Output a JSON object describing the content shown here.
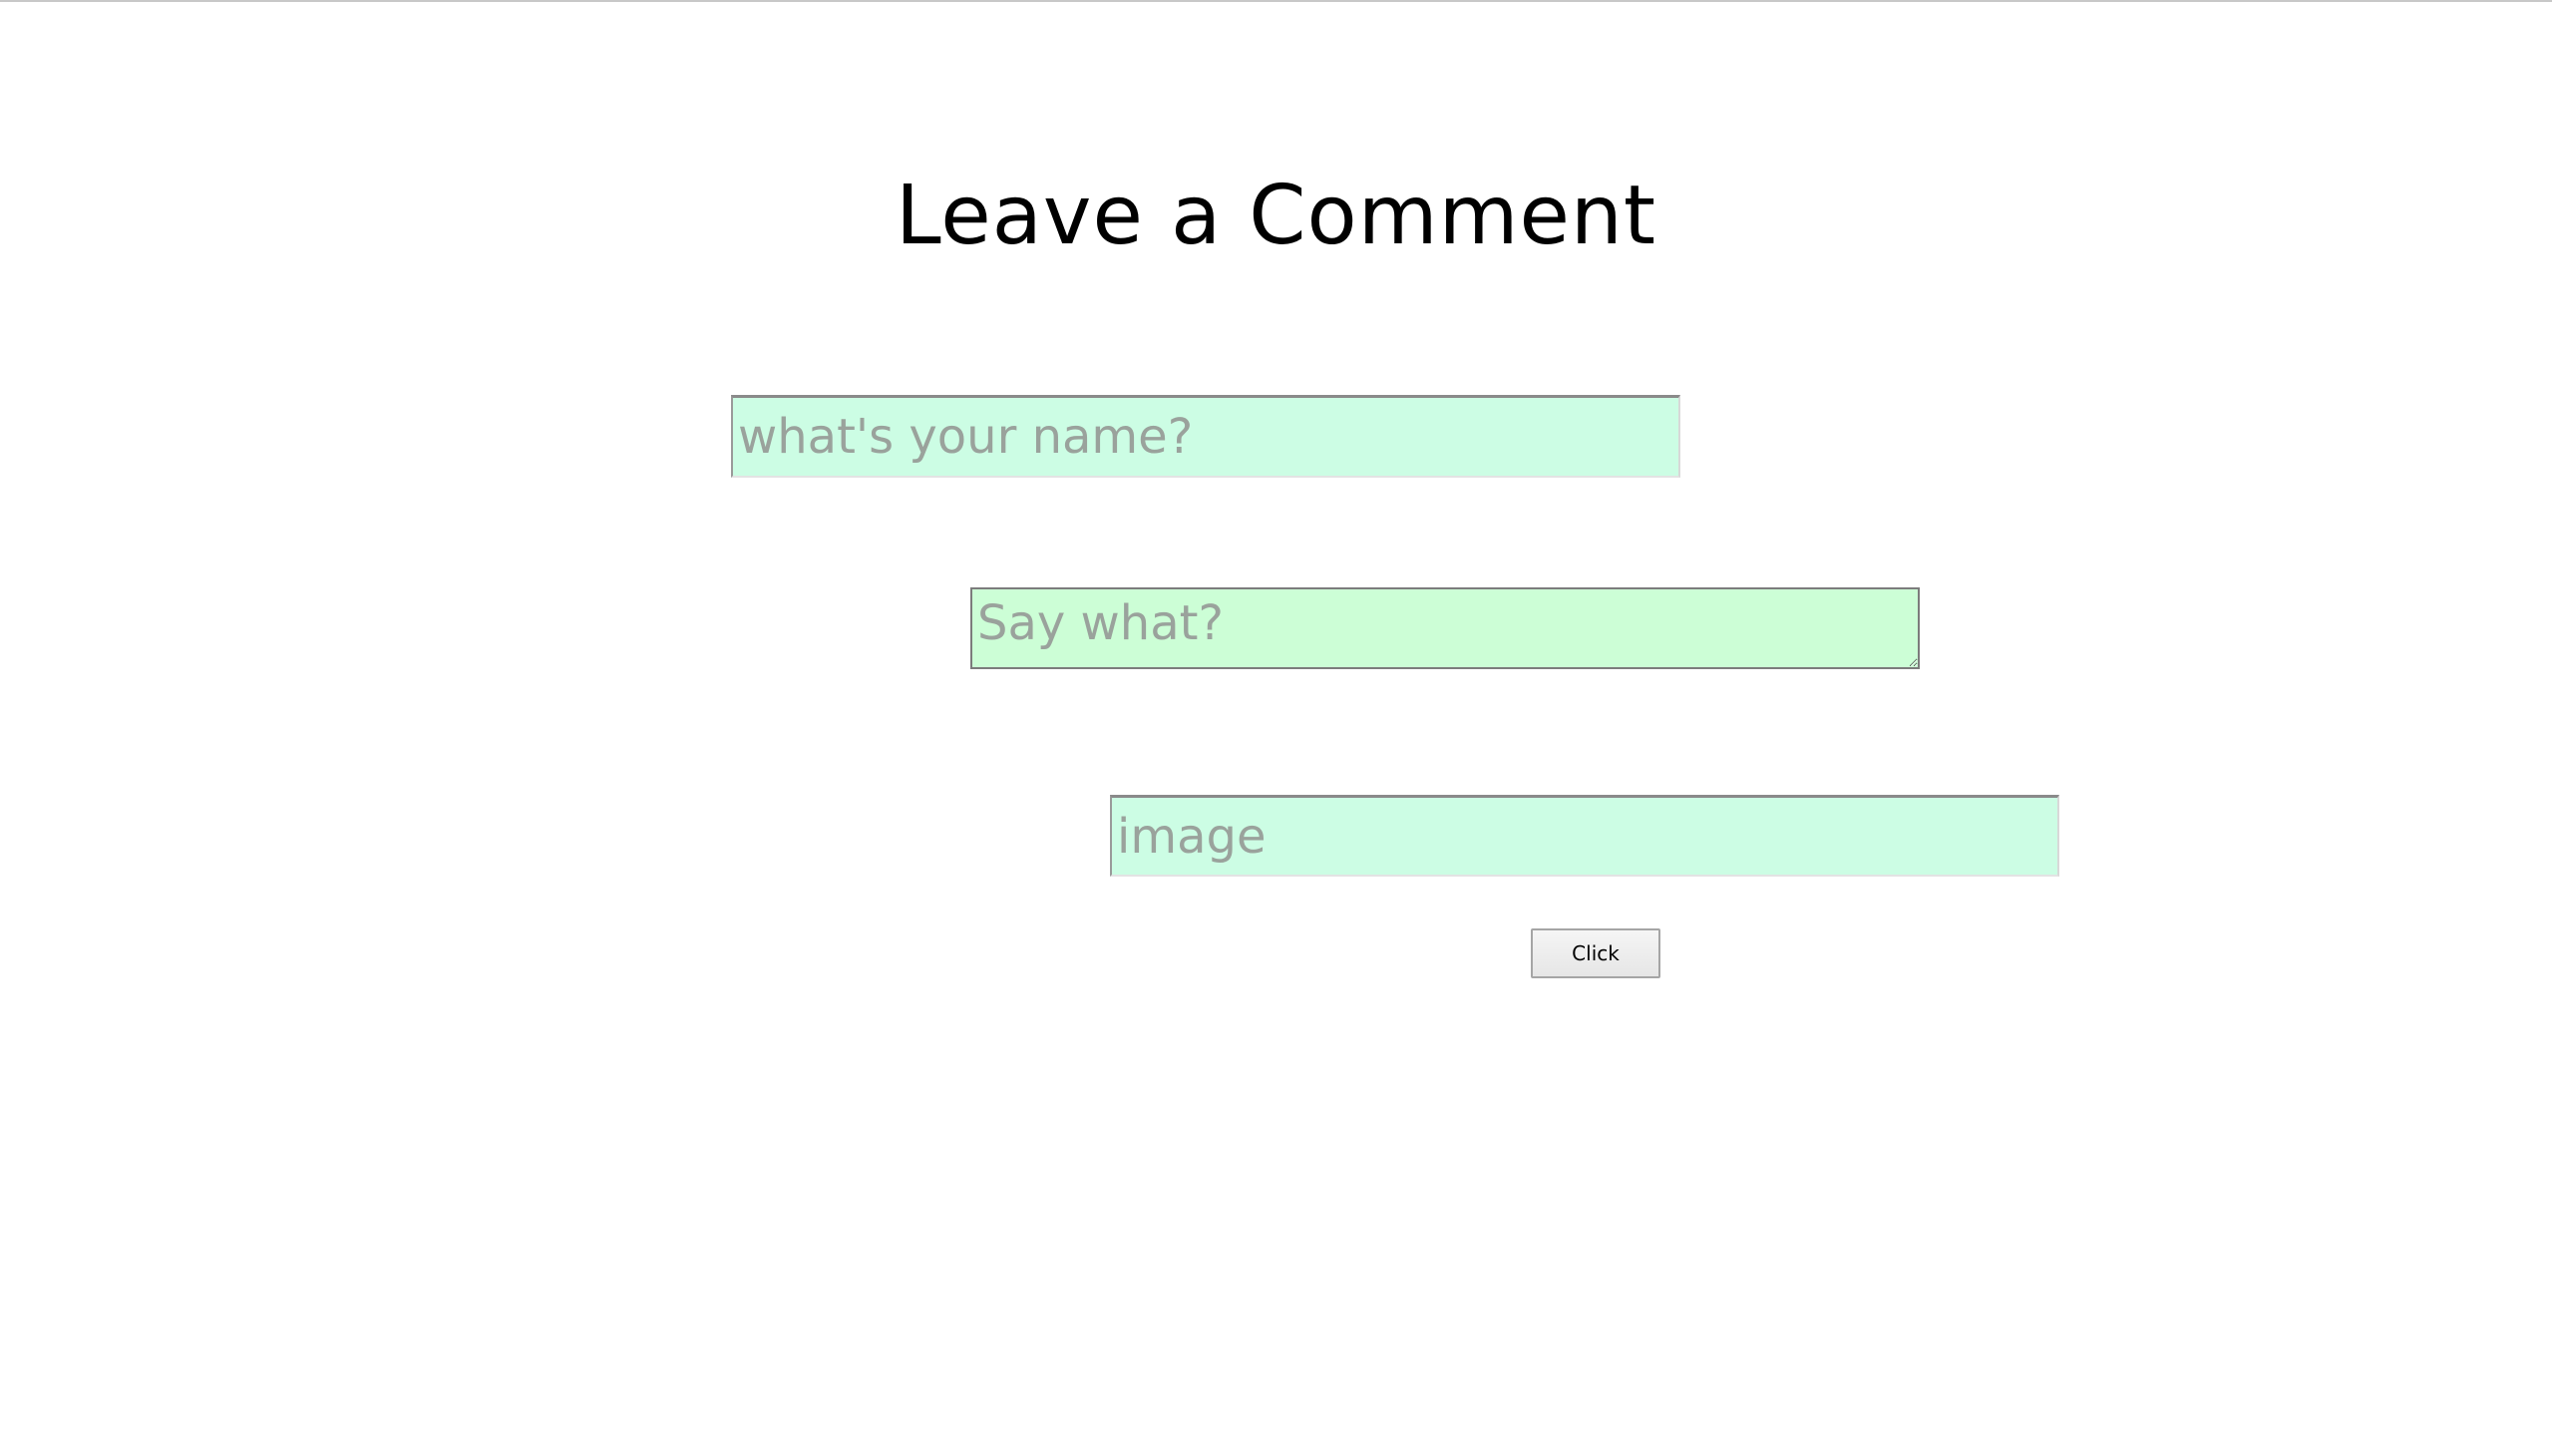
{
  "form": {
    "title": "Leave a Comment",
    "name_placeholder": "what's your name?",
    "comment_placeholder": "Say what?",
    "image_placeholder": "image",
    "submit_label": "Click"
  },
  "colors": {
    "name_field_bg": "#ccfde4",
    "comment_field_bg": "#ccfed6",
    "image_field_bg": "#ccfde4",
    "placeholder_text": "#9aa29c"
  }
}
